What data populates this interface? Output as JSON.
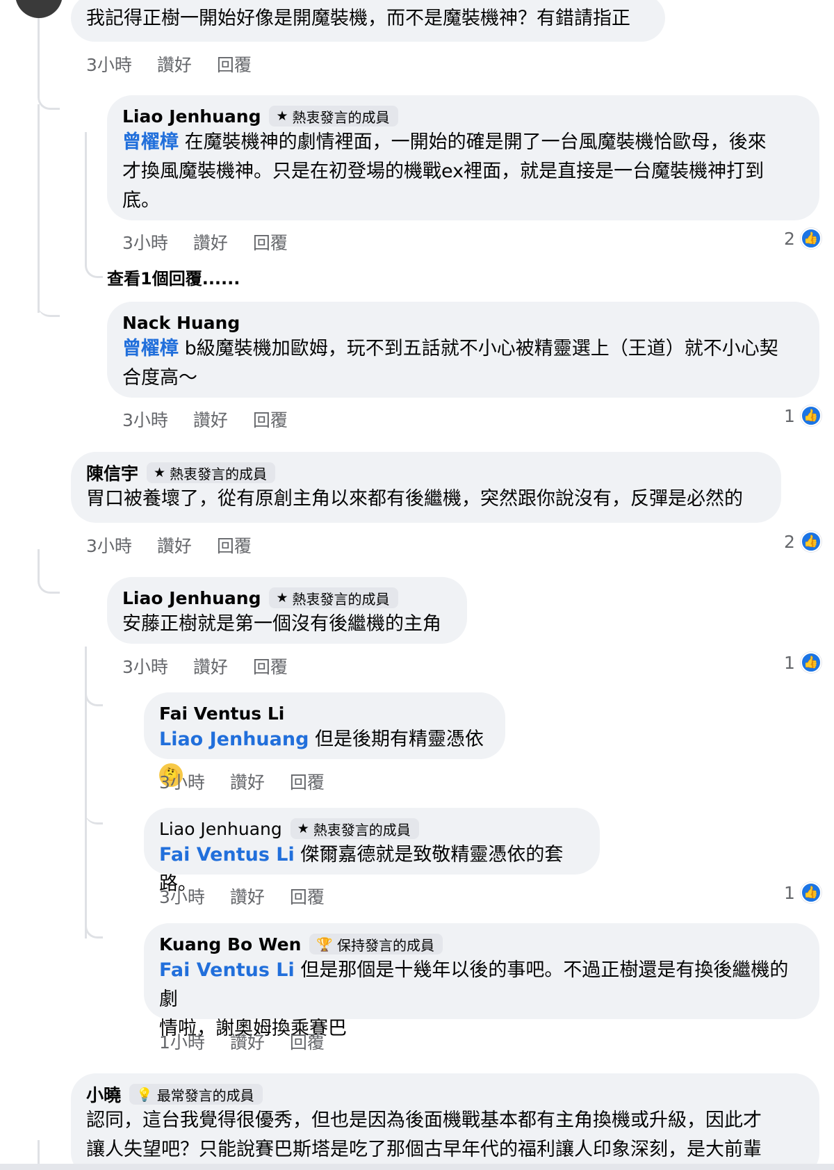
{
  "comments": [
    {
      "text": "我記得正樹一開始好像是開魔裝機，而不是魔裝機神？有錯請指正",
      "time": "3小時",
      "like_label": "讚好",
      "reply_label": "回覆"
    },
    {
      "author": "Liao Jenhuang",
      "badge": "熱衷發言的成員",
      "badge_icon": "star-icon",
      "mention": "曾櫂樟",
      "text_line1": " 在魔裝機神的劇情裡面，一開始的確是開了一台風魔裝機恰歐母，後來",
      "text_line2": "才換風魔裝機神。只是在初登場的機戰ex裡面，就是直接是一台魔裝機神打到",
      "text_line3": "底。",
      "time": "3小時",
      "like_label": "讚好",
      "reply_label": "回覆",
      "reactions": "2"
    },
    {
      "view_replies": "查看1個回覆......"
    },
    {
      "author": "Nack Huang",
      "mention": "曾櫂樟",
      "text_line1": " b級魔裝機加歐姆，玩不到五話就不小心被精靈選上（王道）就不小心契",
      "text_line2": "合度高～",
      "time": "3小時",
      "like_label": "讚好",
      "reply_label": "回覆",
      "reactions": "1"
    },
    {
      "author": "陳信宇",
      "badge": "熱衷發言的成員",
      "badge_icon": "star-icon",
      "text": "胃口被養壞了，從有原創主角以來都有後繼機，突然跟你說沒有，反彈是必然的",
      "time": "3小時",
      "like_label": "讚好",
      "reply_label": "回覆",
      "reactions": "2"
    },
    {
      "author": "Liao Jenhuang",
      "badge": "熱衷發言的成員",
      "badge_icon": "star-icon",
      "text": "安藤正樹就是第一個沒有後繼機的主角",
      "time": "3小時",
      "like_label": "讚好",
      "reply_label": "回覆",
      "reactions": "1"
    },
    {
      "author": "Fai Ventus Li",
      "mention": "Liao Jenhuang",
      "text": " 但是後期有精靈憑依",
      "emoji": "thinking-face-emoji",
      "time": "3小時",
      "like_label": "讚好",
      "reply_label": "回覆"
    },
    {
      "author": "Liao Jenhuang",
      "badge": "熱衷發言的成員",
      "badge_icon": "star-icon",
      "mention": "Fai Ventus Li",
      "text": " 傑爾嘉德就是致敬精靈憑依的套路。",
      "time": "3小時",
      "like_label": "讚好",
      "reply_label": "回覆",
      "reactions": "1"
    },
    {
      "author": "Kuang Bo Wen",
      "badge": "保持發言的成員",
      "badge_icon": "trophy-icon",
      "mention": "Fai Ventus Li",
      "text_line1": " 但是那個是十幾年以後的事吧。不過正樹還是有換後繼機的劇",
      "text_line2": "情啦，謝奧姆換乘賽巴",
      "time": "1小時",
      "like_label": "讚好",
      "reply_label": "回覆"
    },
    {
      "author": "小曉",
      "badge": "最常發言的成員",
      "badge_icon": "bulb-icon",
      "text_line1": "認同，這台我覺得很優秀，但也是因為後面機戰基本都有主角換機或升級，因此才",
      "text_line2": "讓人失望吧？只能說賽巴斯塔是吃了那個古早年代的福利讓人印象深刻，是大前輩"
    }
  ],
  "colors": {
    "bubble": "#f0f2f5",
    "mention": "#216fdb",
    "like": "#1b74e4",
    "meta": "#65676b"
  }
}
